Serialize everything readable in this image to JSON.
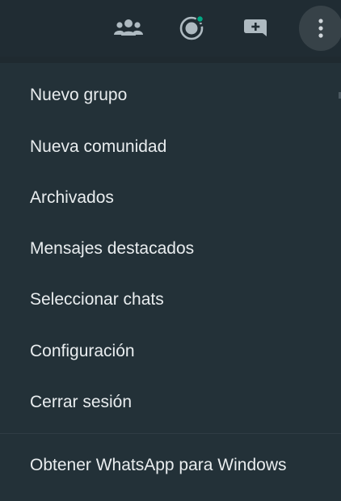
{
  "header": {
    "icons": [
      "community-icon",
      "status-icon",
      "new-chat-icon",
      "menu-icon"
    ],
    "status_dot_color": "#00a884",
    "icon_color": "#aebac1"
  },
  "menu": {
    "items": [
      {
        "label": "Nuevo grupo"
      },
      {
        "label": "Nueva comunidad"
      },
      {
        "label": "Archivados"
      },
      {
        "label": "Mensajes destacados"
      },
      {
        "label": "Seleccionar chats"
      },
      {
        "label": "Configuración"
      },
      {
        "label": "Cerrar sesión"
      }
    ],
    "footer_item": {
      "label": "Obtener WhatsApp para Windows"
    }
  }
}
